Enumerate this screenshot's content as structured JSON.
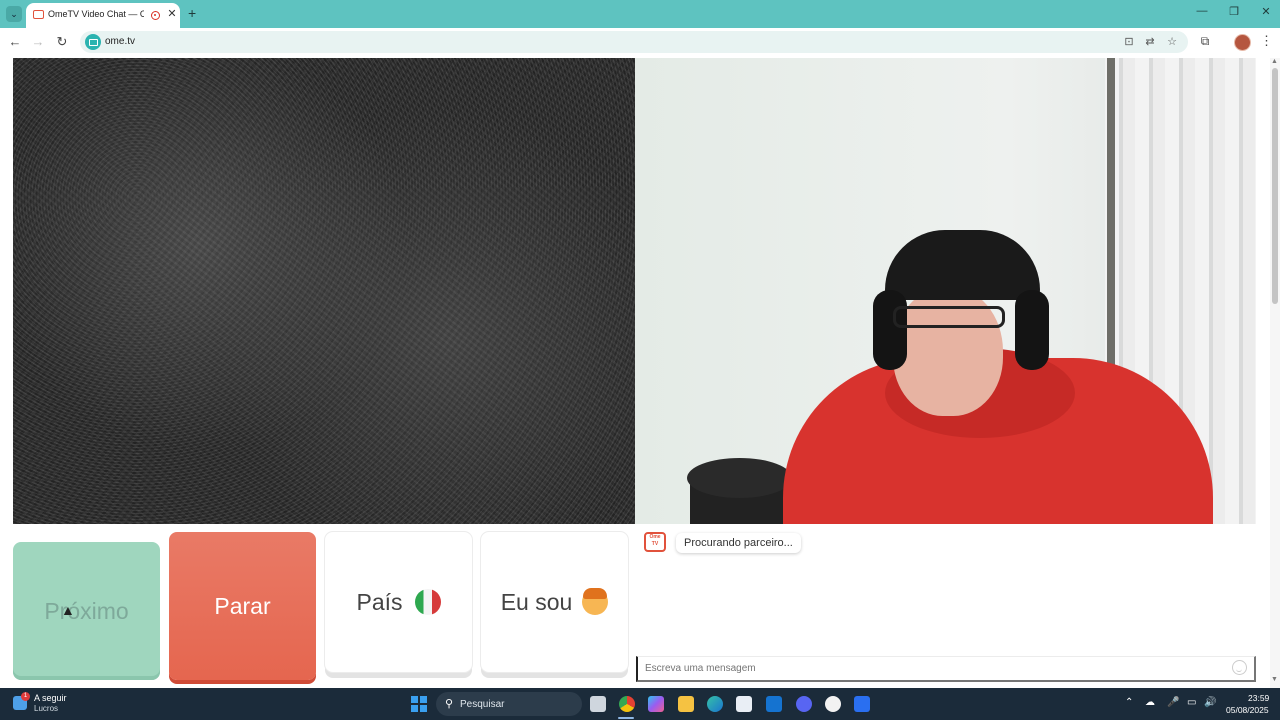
{
  "browser": {
    "tab_title": "OmeTV Video Chat — Ome",
    "tab_close": "✕",
    "new_tab": "+",
    "url": "ome.tv",
    "window_controls": {
      "minimize": "—",
      "restore": "❐",
      "close": "✕"
    }
  },
  "icons": {
    "back": "←",
    "forward": "→",
    "reload": "↻",
    "install": "⊡",
    "translate": "⇄",
    "bookmark": "☆",
    "extensions": "⧉",
    "menu": "⋮",
    "tab_list": "⌄"
  },
  "remote_video": {
    "state": "static"
  },
  "controls": {
    "next_label": "Próximo",
    "stop_label": "Parar",
    "country_label": "País",
    "iam_label": "Eu sou"
  },
  "chat": {
    "logo_text": "Ome TV",
    "status_message": "Procurando parceiro...",
    "input_placeholder": "Escreva uma mensagem"
  },
  "taskbar": {
    "widget_title": "A seguir",
    "widget_subtitle": "Lucros",
    "widget_badge": "1",
    "search_placeholder": "Pesquisar",
    "time": "23:59",
    "date": "05/08/2025"
  },
  "colors": {
    "tab_strip": "#5ec3c0",
    "next_button": "#9fd6be",
    "stop_button": "#e5664f"
  }
}
